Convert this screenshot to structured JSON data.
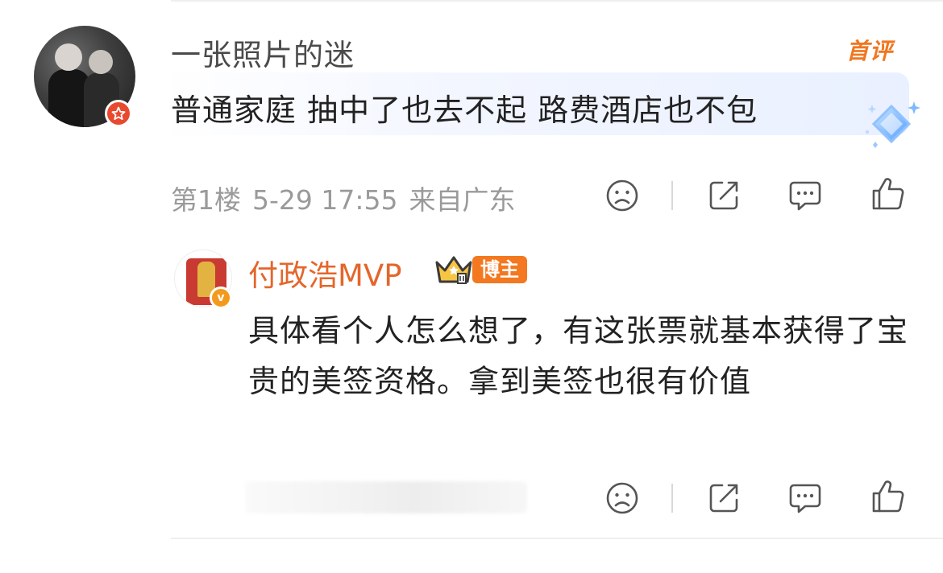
{
  "main_comment": {
    "username": "一张照片的迷",
    "badge": "首评",
    "text": "普通家庭 抽中了也去不起 路费酒店也不包",
    "meta": {
      "floor": "第1楼",
      "date_time": "5-29 17:55",
      "location": "来自广东"
    },
    "actions": [
      "sad-face-icon",
      "share-icon",
      "comment-icon",
      "like-icon"
    ]
  },
  "reply": {
    "username": "付政浩MVP",
    "host_tag": "博主",
    "text": "具体看个人怎么想了，有这张票就基本获得了宝贵的美签资格。拿到美签也很有价值",
    "actions": [
      "sad-face-icon",
      "share-icon",
      "comment-icon",
      "like-icon"
    ]
  },
  "colors": {
    "accent_orange": "#f0761f",
    "reply_name": "#e4662b",
    "meta_gray": "#9a9a9a",
    "text": "#222222"
  }
}
